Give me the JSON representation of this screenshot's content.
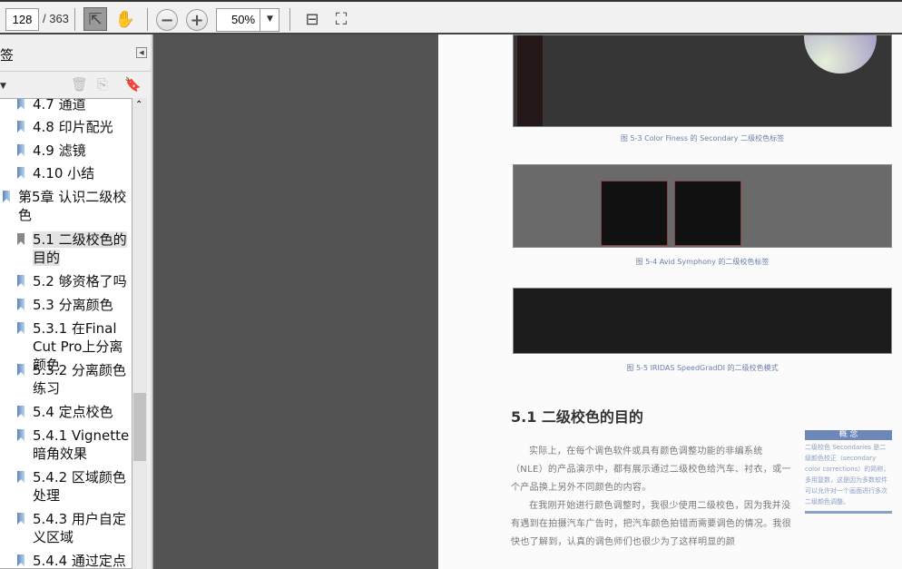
{
  "toolbar": {
    "page_current": "128",
    "page_total": "/ 363",
    "zoom": "50%"
  },
  "sidebar": {
    "title": "签",
    "items": [
      {
        "label": "4.7 通道"
      },
      {
        "label": "4.8 印片配光"
      },
      {
        "label": "4.9 滤镜"
      },
      {
        "label": "4.10 小结"
      },
      {
        "label": "第5章 认识二级校色"
      },
      {
        "label": "5.1 二级校色的目的"
      },
      {
        "label": "5.2 够资格了吗"
      },
      {
        "label": "5.3 分离颜色"
      },
      {
        "label": "5.3.1 在Final Cut Pro上分离颜色"
      },
      {
        "label": "5.3.2 分离颜色练习"
      },
      {
        "label": "5.4 定点校色"
      },
      {
        "label": "5.4.1 Vignette暗角效果"
      },
      {
        "label": "5.4.2 区域颜色处理"
      },
      {
        "label": "5.4.3 用户自定义区域"
      },
      {
        "label": "5.4.4 通过定点"
      }
    ]
  },
  "page": {
    "captions": [
      "图 5-3  Color Finess 的 Secondary 二级校色标签",
      "图 5-4  Avid Symphony 的二级校色标签",
      "图 5-5  IRIDAS SpeedGradDI 的二级校色模式"
    ],
    "heading": "5.1   二级校色的目的",
    "para1": "实际上，在每个调色软件或具有颜色调整功能的非编系统（NLE）的产品演示中，都有展示通过二级校色给汽车、衬衣，或一个产品换上另外不同颜色的内容。",
    "para2": "在我刚开始进行颜色调整时，我很少使用二级校色，因为我并没有遇到在拍摄汽车广告时，把汽车颜色拍错而需要调色的情况。我很快也了解到，认真的调色师们也很少为了这样明显的颜",
    "concept_title": "概  念",
    "concept_body": "二级校色 Secondaries 是二级颜色校正（secondary color corrections）的简称，多用复数，这是因为多数软件可以允许对一个画面进行多次二级颜色调整。"
  }
}
